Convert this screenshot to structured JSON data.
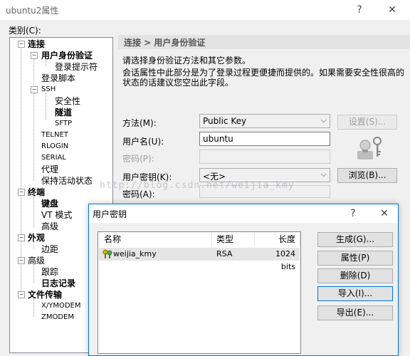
{
  "window": {
    "title": "ubuntu2属性",
    "help_glyph": "?",
    "close_glyph": "✕"
  },
  "category_label": "类别(C):",
  "tree": {
    "connection": "连接",
    "user_auth": "用户身份验证",
    "login_prompt": "登录提示符",
    "login_script": "登录脚本",
    "ssh": "SSH",
    "security": "安全性",
    "tunnel": "隧道",
    "sftp": "SFTP",
    "telnet": "TELNET",
    "rlogin": "RLOGIN",
    "serial": "SERIAL",
    "proxy": "代理",
    "keepalive": "保持活动状态",
    "terminal": "终端",
    "keyboard": "键盘",
    "vt_mode": "VT 模式",
    "advanced": "高级",
    "appearance": "外观",
    "margin": "边距",
    "advanced2": "高级",
    "trace": "跟踪",
    "log": "日志记录",
    "file_transfer": "文件传输",
    "xymodem": "X/YMODEM",
    "zmodem": "ZMODEM"
  },
  "header": {
    "breadcrumb": "连接 > 用户身份验证"
  },
  "description": {
    "line1": "请选择身份验证方法和其它参数。",
    "line2": "会话属性中此部分是为了登录过程更便捷而提供的。如果需要安全性很高的状态的话建议您空出此字段。"
  },
  "form": {
    "method_label": "方法(M):",
    "method_value": "Public Key",
    "settings_button": "设置(S)...",
    "username_label": "用户名(U):",
    "username_value": "ubuntu",
    "password_label": "密码(P):",
    "password_value": "",
    "user_key_label": "用户密钥(K):",
    "user_key_value": "<无>",
    "browse_button": "浏览(B)...",
    "passphrase_label": "密码(A):"
  },
  "watermark": "http://blog.csdn.net/weijia_kmy",
  "dialog": {
    "title": "用户密钥",
    "help_glyph": "?",
    "close_glyph": "✕",
    "columns": [
      "名称",
      "类型",
      "长度"
    ],
    "rows": [
      {
        "name": "weijia_kmy",
        "type": "RSA",
        "length": "1024 bits"
      }
    ],
    "buttons": {
      "generate": "生成(G)...",
      "properties": "属性(P)",
      "delete": "删除(D)",
      "import": "导入(I)...",
      "export": "导出(E)..."
    }
  },
  "icons": {
    "key_icon": "user-key-icon"
  }
}
